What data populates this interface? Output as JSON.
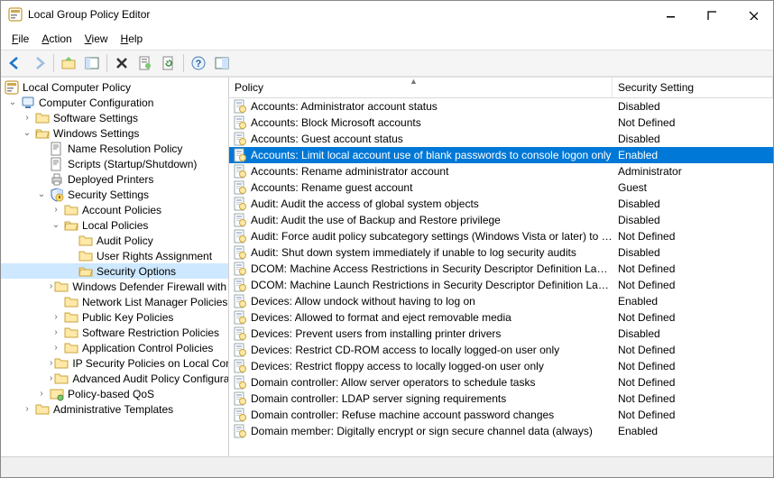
{
  "window": {
    "title": "Local Group Policy Editor"
  },
  "menu": {
    "file": "File",
    "action": "Action",
    "view": "View",
    "help": "Help"
  },
  "tree": {
    "root": "Local Computer Policy",
    "cc": "Computer Configuration",
    "ss": "Software Settings",
    "ws": "Windows Settings",
    "nrp": "Name Resolution Policy",
    "scripts": "Scripts (Startup/Shutdown)",
    "dp": "Deployed Printers",
    "secset": "Security Settings",
    "ap": "Account Policies",
    "lp": "Local Policies",
    "audit": "Audit Policy",
    "ura": "User Rights Assignment",
    "so": "Security Options",
    "wdf": "Windows Defender Firewall with Advanced Security",
    "nlmp": "Network List Manager Policies",
    "pkp": "Public Key Policies",
    "srp": "Software Restriction Policies",
    "acp": "Application Control Policies",
    "ipsec": "IP Security Policies on Local Computer",
    "aapc": "Advanced Audit Policy Configuration",
    "pbq": "Policy-based QoS",
    "at": "Administrative Templates"
  },
  "list": {
    "hdr_policy": "Policy",
    "hdr_setting": "Security Setting",
    "rows": [
      {
        "p": "Accounts: Administrator account status",
        "s": "Disabled"
      },
      {
        "p": "Accounts: Block Microsoft accounts",
        "s": "Not Defined"
      },
      {
        "p": "Accounts: Guest account status",
        "s": "Disabled"
      },
      {
        "p": "Accounts: Limit local account use of blank passwords to console logon only",
        "s": "Enabled",
        "sel": true
      },
      {
        "p": "Accounts: Rename administrator account",
        "s": "Administrator"
      },
      {
        "p": "Accounts: Rename guest account",
        "s": "Guest"
      },
      {
        "p": "Audit: Audit the access of global system objects",
        "s": "Disabled"
      },
      {
        "p": "Audit: Audit the use of Backup and Restore privilege",
        "s": "Disabled"
      },
      {
        "p": "Audit: Force audit policy subcategory settings (Windows Vista or later) to o...",
        "s": "Not Defined"
      },
      {
        "p": "Audit: Shut down system immediately if unable to log security audits",
        "s": "Disabled"
      },
      {
        "p": "DCOM: Machine Access Restrictions in Security Descriptor Definition Lang...",
        "s": "Not Defined"
      },
      {
        "p": "DCOM: Machine Launch Restrictions in Security Descriptor Definition Lang...",
        "s": "Not Defined"
      },
      {
        "p": "Devices: Allow undock without having to log on",
        "s": "Enabled"
      },
      {
        "p": "Devices: Allowed to format and eject removable media",
        "s": "Not Defined"
      },
      {
        "p": "Devices: Prevent users from installing printer drivers",
        "s": "Disabled"
      },
      {
        "p": "Devices: Restrict CD-ROM access to locally logged-on user only",
        "s": "Not Defined"
      },
      {
        "p": "Devices: Restrict floppy access to locally logged-on user only",
        "s": "Not Defined"
      },
      {
        "p": "Domain controller: Allow server operators to schedule tasks",
        "s": "Not Defined"
      },
      {
        "p": "Domain controller: LDAP server signing requirements",
        "s": "Not Defined"
      },
      {
        "p": "Domain controller: Refuse machine account password changes",
        "s": "Not Defined"
      },
      {
        "p": "Domain member: Digitally encrypt or sign secure channel data (always)",
        "s": "Enabled"
      }
    ]
  }
}
